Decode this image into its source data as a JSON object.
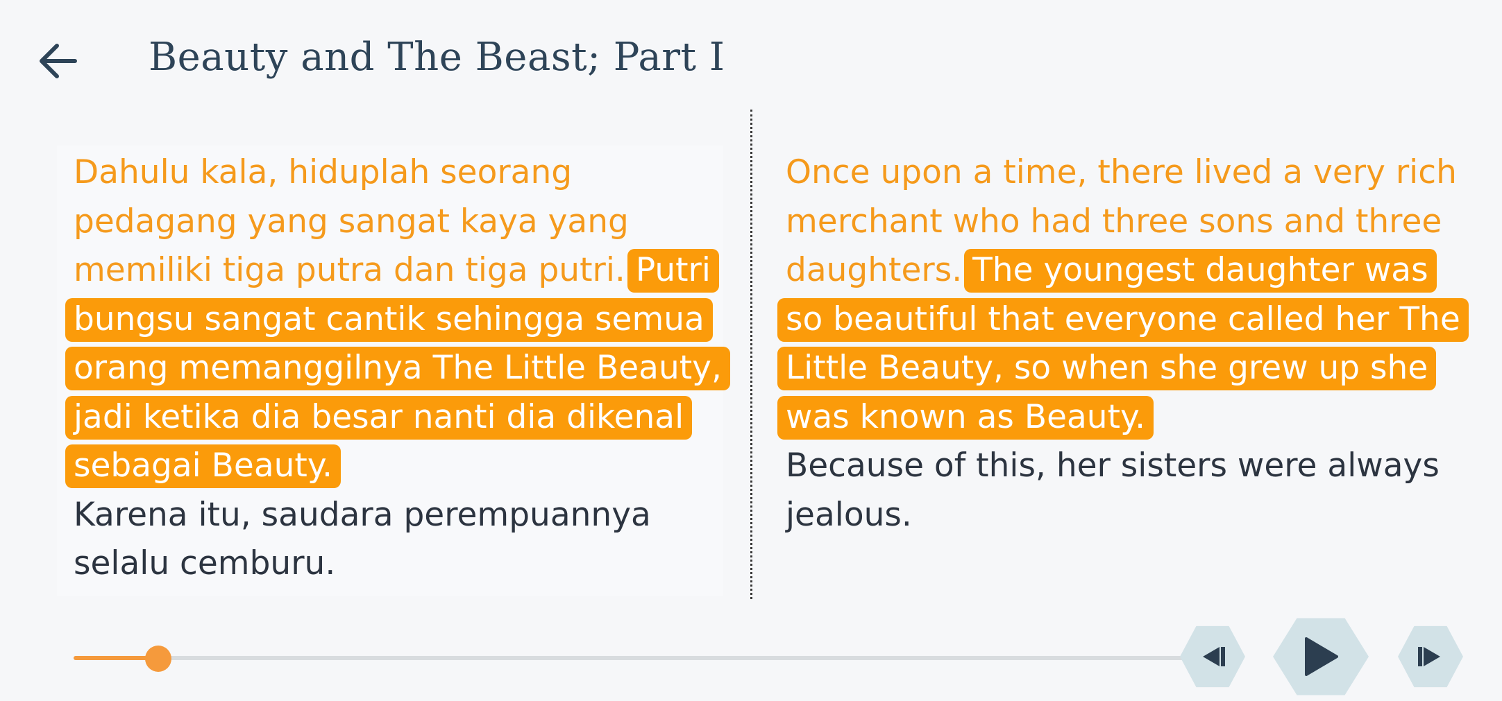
{
  "header": {
    "title": "Beauty and The Beast; Part I"
  },
  "icons": {
    "back": "arrow-left-icon",
    "previous": "skip-previous-icon",
    "play": "play-icon",
    "next": "skip-next-icon"
  },
  "colors": {
    "accent": "#fb9b0a",
    "read_text": "#f59a1c",
    "unread_text": "#2c3440",
    "title": "#2e4458",
    "control_bg": "#d2e2e7"
  },
  "story": {
    "source": {
      "read": "Dahulu kala, hiduplah seorang pedagang yang sangat kaya yang memiliki tiga putra dan tiga putri.",
      "current": "Putri bungsu sangat cantik sehingga semua orang memanggilnya The Little Beauty, jadi ketika dia besar nanti dia dikenal sebagai Beauty.",
      "upcoming": "Karena itu, saudara perempuannya selalu cemburu."
    },
    "translation": {
      "read": "Once upon a time, there lived a very rich merchant who had three sons and three daughters.",
      "current": "The youngest daughter was so beautiful that everyone called her The Little Beauty, so when she grew up she was known as Beauty.",
      "upcoming": "Because of this, her sisters were always jealous."
    }
  },
  "player": {
    "progress": 0.075
  }
}
